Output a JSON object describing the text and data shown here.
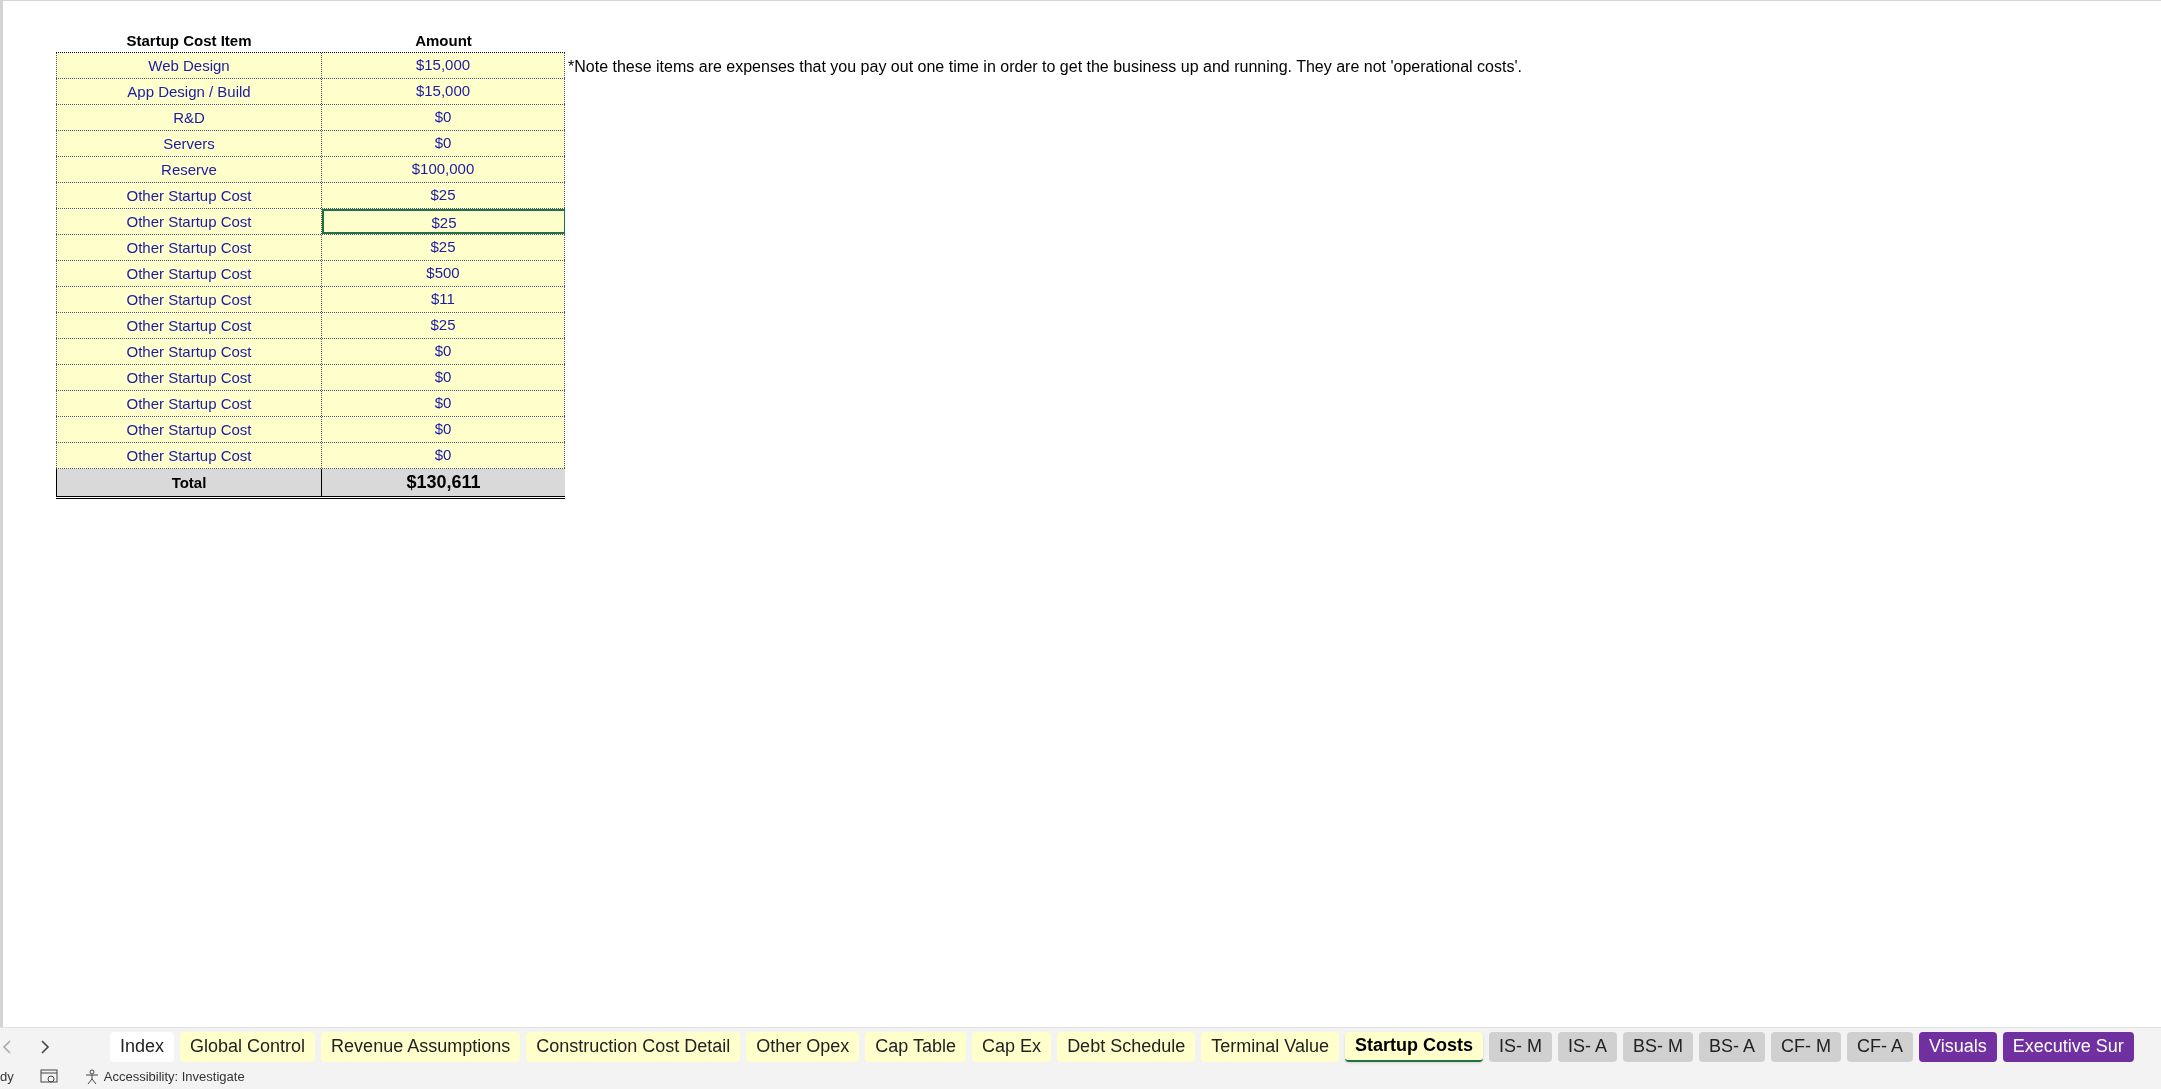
{
  "table": {
    "columns": [
      "Startup Cost Item",
      "Amount"
    ],
    "rows": [
      {
        "item": "Web Design",
        "amount": "$15,000",
        "selected": false
      },
      {
        "item": "App Design / Build",
        "amount": "$15,000",
        "selected": false
      },
      {
        "item": "R&D",
        "amount": "$0",
        "selected": false
      },
      {
        "item": "Servers",
        "amount": "$0",
        "selected": false
      },
      {
        "item": "Reserve",
        "amount": "$100,000",
        "selected": false
      },
      {
        "item": "Other Startup Cost",
        "amount": "$25",
        "selected": false
      },
      {
        "item": "Other Startup Cost",
        "amount": "$25",
        "selected": true
      },
      {
        "item": "Other Startup Cost",
        "amount": "$25",
        "selected": false
      },
      {
        "item": "Other Startup Cost",
        "amount": "$500",
        "selected": false
      },
      {
        "item": "Other Startup Cost",
        "amount": "$11",
        "selected": false
      },
      {
        "item": "Other Startup Cost",
        "amount": "$25",
        "selected": false
      },
      {
        "item": "Other Startup Cost",
        "amount": "$0",
        "selected": false
      },
      {
        "item": "Other Startup Cost",
        "amount": "$0",
        "selected": false
      },
      {
        "item": "Other Startup Cost",
        "amount": "$0",
        "selected": false
      },
      {
        "item": "Other Startup Cost",
        "amount": "$0",
        "selected": false
      },
      {
        "item": "Other Startup Cost",
        "amount": "$0",
        "selected": false
      }
    ],
    "total": {
      "label": "Total",
      "amount": "$130,611"
    }
  },
  "note": "*Note these items are expenses that you pay out one time in order to get the business up and running. They are not 'operational costs'.",
  "sheet_tabs": [
    {
      "label": "Index",
      "color": "#ffffff",
      "selected": false
    },
    {
      "label": "Global Control",
      "color": "#ffffcc",
      "selected": false
    },
    {
      "label": "Revenue Assumptions",
      "color": "#ffffcc",
      "selected": false
    },
    {
      "label": "Construction Cost Detail",
      "color": "#ffffcc",
      "selected": false
    },
    {
      "label": "Other Opex",
      "color": "#ffffcc",
      "selected": false
    },
    {
      "label": "Cap Table",
      "color": "#ffffcc",
      "selected": false
    },
    {
      "label": "Cap Ex",
      "color": "#ffffcc",
      "selected": false
    },
    {
      "label": "Debt Schedule",
      "color": "#ffffcc",
      "selected": false
    },
    {
      "label": "Terminal Value",
      "color": "#ffffcc",
      "selected": false
    },
    {
      "label": "Startup Costs",
      "color": "#ffffcc",
      "selected": true
    },
    {
      "label": "IS- M",
      "color": "#d0d0d0",
      "selected": false
    },
    {
      "label": "IS- A",
      "color": "#d0d0d0",
      "selected": false
    },
    {
      "label": "BS- M",
      "color": "#d0d0d0",
      "selected": false
    },
    {
      "label": "BS- A",
      "color": "#d0d0d0",
      "selected": false
    },
    {
      "label": "CF- M",
      "color": "#d0d0d0",
      "selected": false
    },
    {
      "label": "CF- A",
      "color": "#d0d0d0",
      "selected": false
    },
    {
      "label": "Visuals",
      "color": "#7030a0",
      "selected": false
    },
    {
      "label": "Executive Sur",
      "color": "#7030a0",
      "selected": false
    }
  ],
  "status_bar": {
    "mode": "dy",
    "accessibility": "Accessibility: Investigate"
  }
}
